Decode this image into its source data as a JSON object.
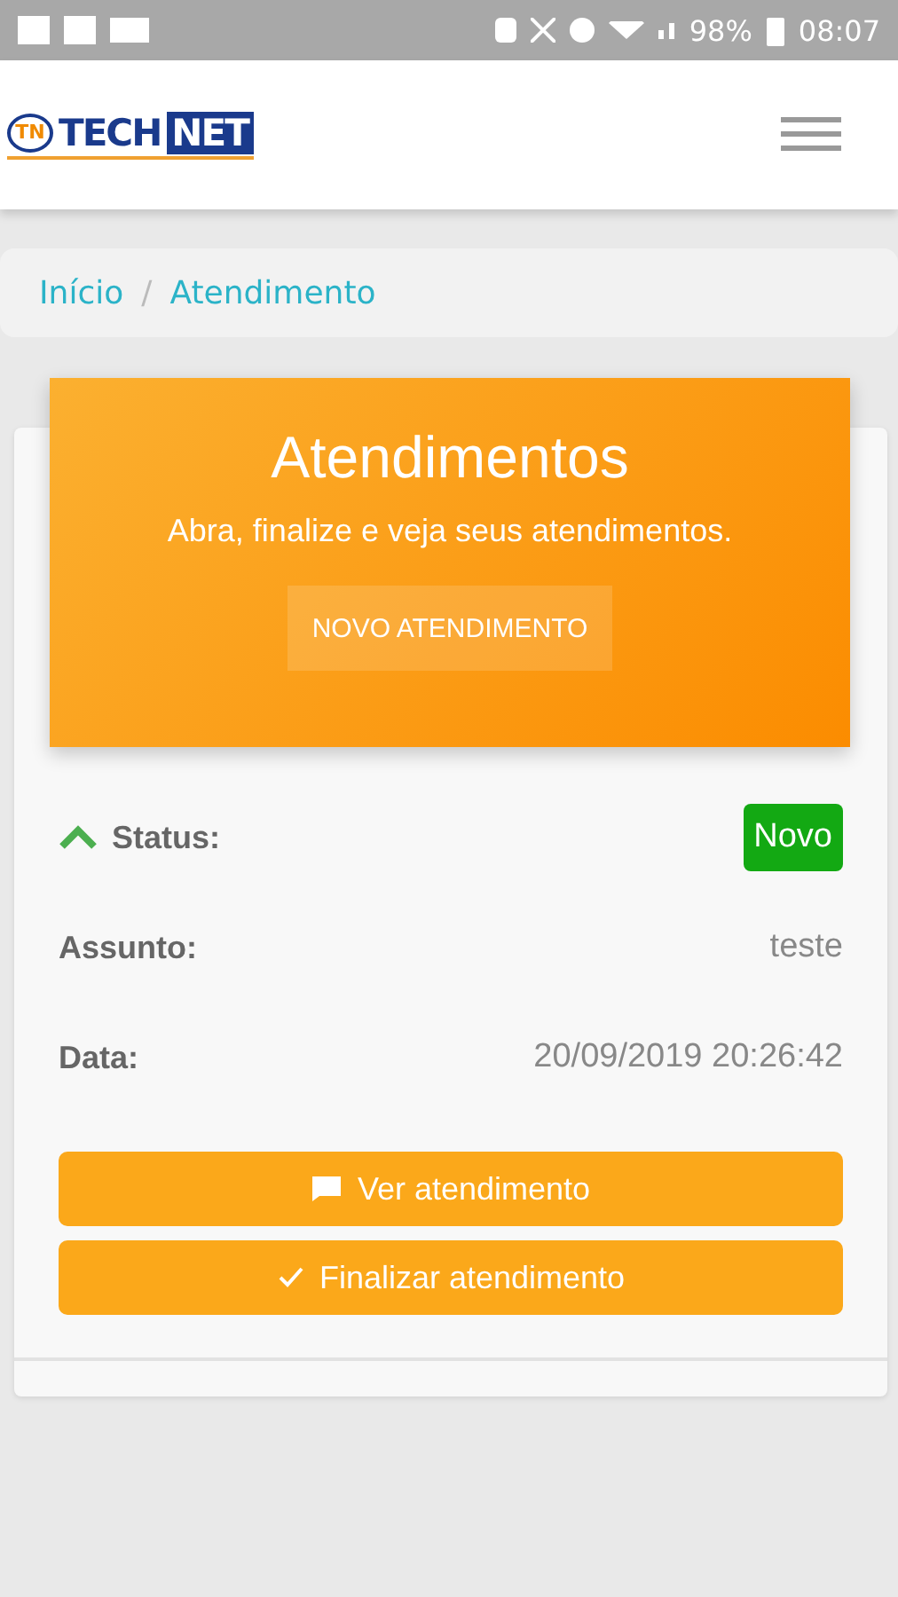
{
  "status_bar": {
    "battery": "98%",
    "time": "08:07"
  },
  "header": {
    "logo": {
      "badge": "TN",
      "first": "TECH",
      "second": "NET"
    }
  },
  "breadcrumb_separator": "/",
  "breadcrumb": [
    {
      "label": "Início"
    },
    {
      "label": "Atendimento"
    }
  ],
  "hero": {
    "title": "Atendimentos",
    "subtitle": "Abra, finalize e veja seus atendimentos.",
    "button": "NOVO ATENDIMENTO"
  },
  "ticket": {
    "expanded": true,
    "status": {
      "label": "Status:",
      "value": "Novo",
      "color": "#13a913"
    },
    "fields": [
      {
        "label": "Assunto:",
        "value": "teste"
      },
      {
        "label": "Data:",
        "value": "20/09/2019 20:26:42"
      }
    ],
    "actions": [
      {
        "kind": "chat",
        "label": "Ver atendimento"
      },
      {
        "kind": "check",
        "label": "Finalizar atendimento"
      }
    ]
  }
}
